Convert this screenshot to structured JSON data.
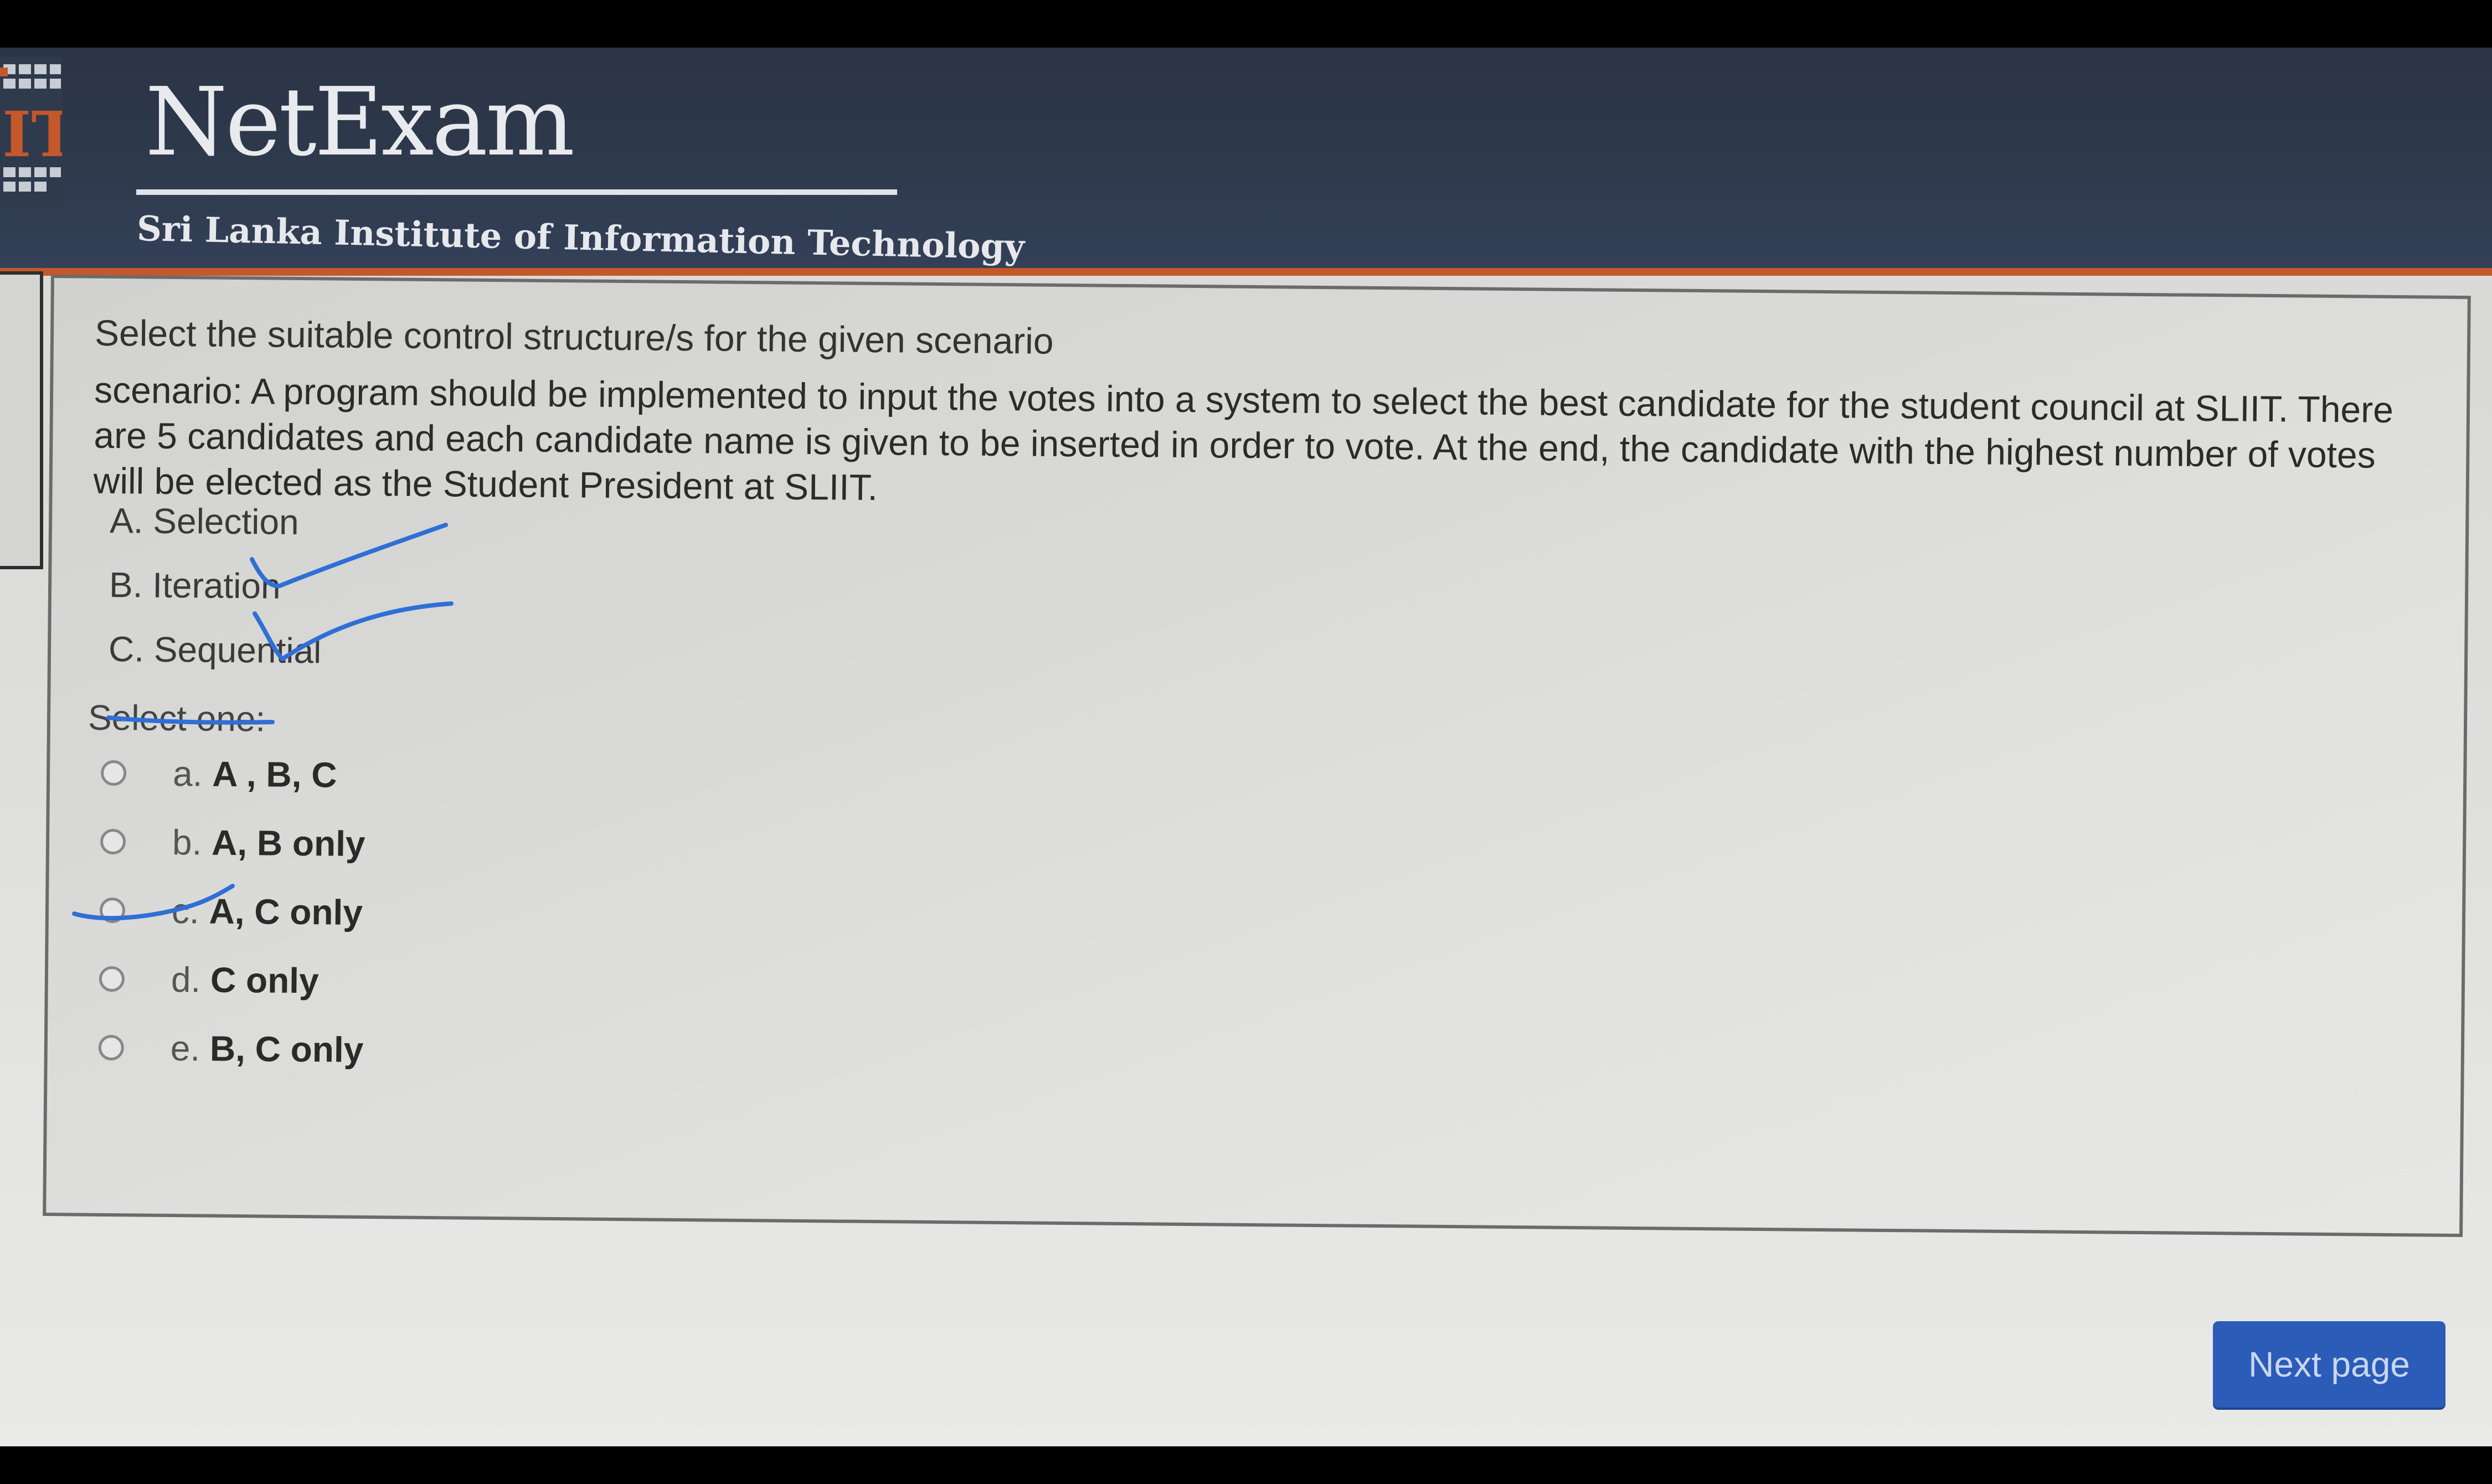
{
  "header": {
    "app_name": "NetExam",
    "institute": "Sri Lanka Institute of Information Technology",
    "logo_text": "IT"
  },
  "question": {
    "title": "Select the suitable control structure/s for the given scenario",
    "scenario": "scenario: A program should be implemented to input the votes into a system to select the best candidate for the student council at SLIIT. There are 5 candidates and each candidate name is given to be inserted in order to vote. At the end, the candidate with the highest number of votes will be elected as the Student President at SLIIT.",
    "options": [
      {
        "label": "A. Selection"
      },
      {
        "label": "B. Iteration"
      },
      {
        "label": "C. Sequential"
      }
    ],
    "select_prompt": "Select one:",
    "answers": [
      {
        "letter": "a.",
        "text": "A , B, C"
      },
      {
        "letter": "b.",
        "text": "A, B only"
      },
      {
        "letter": "c.",
        "text": "A, C only"
      },
      {
        "letter": "d.",
        "text": "C only"
      },
      {
        "letter": "e.",
        "text": "B, C only"
      }
    ]
  },
  "navigation": {
    "next_label": "Next page"
  },
  "colors": {
    "header_bg": "#2f3a4d",
    "header_accent": "#c4582a",
    "button_bg": "#2a5cb8",
    "pen_ink": "#2f6fd6"
  }
}
